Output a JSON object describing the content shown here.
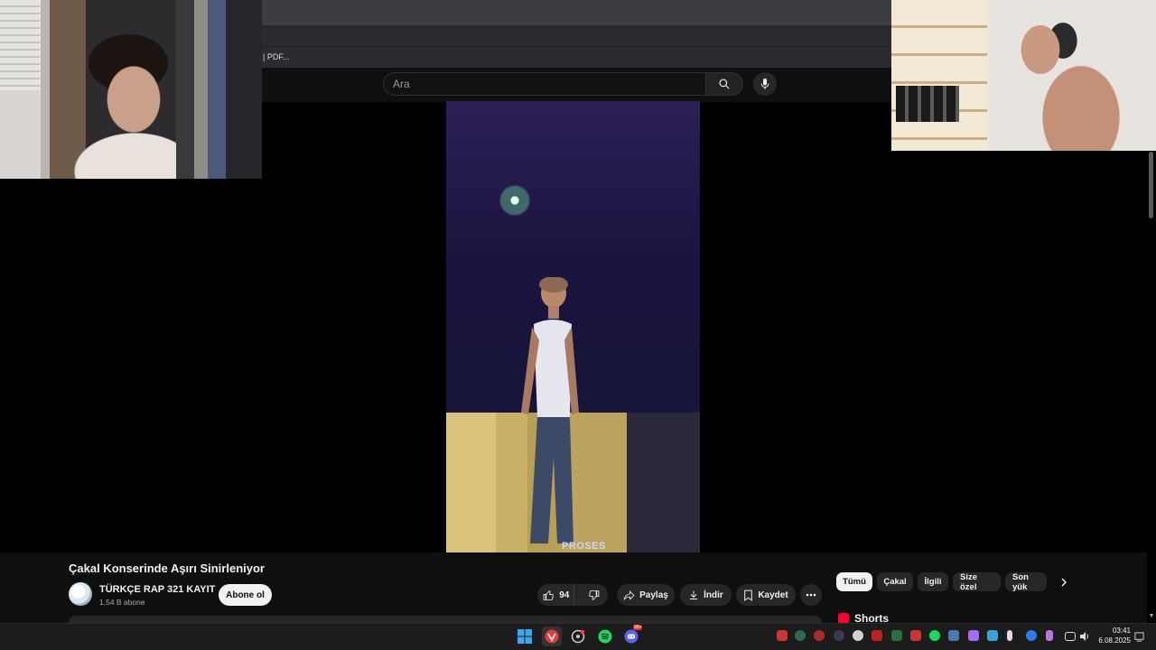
{
  "browser": {
    "bookmark_label": "F | PDF..."
  },
  "youtube": {
    "search": {
      "placeholder": "Ara"
    },
    "video": {
      "watermark": "PROSES",
      "title": "Çakal Konserinde Aşırı Sinirleniyor"
    },
    "channel": {
      "name": "TÜRKÇE RAP 321 KAYIT",
      "subscribers": "1,54 B abone",
      "subscribe_label": "Abone ol"
    },
    "actions": {
      "likes": "94",
      "share_label": "Paylaş",
      "download_label": "İndir",
      "save_label": "Kaydet"
    },
    "chips": [
      "Tümü",
      "Çakal",
      "İlgili",
      "Size özel",
      "Son yük"
    ],
    "shorts_label": "Shorts"
  },
  "taskbar": {
    "time": "03:41",
    "date": "6.08.2025",
    "discord_badge": "99+"
  },
  "colors": {
    "page_bg": "#000000",
    "yt_bg": "#0f0f0f",
    "pill_bg": "#272727",
    "accent_red": "#ff0033"
  }
}
